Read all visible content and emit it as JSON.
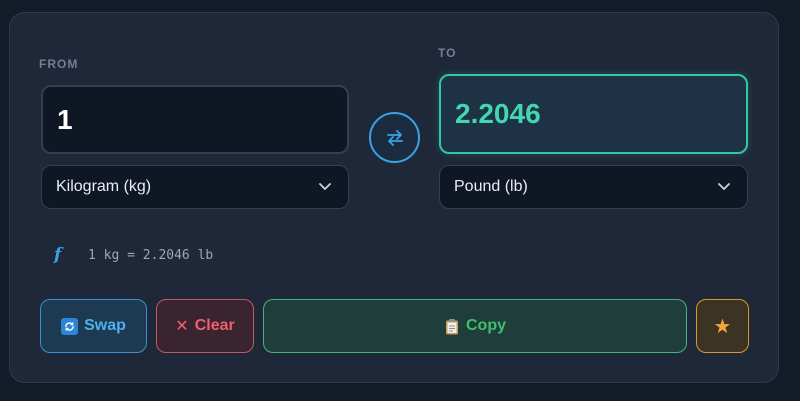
{
  "from": {
    "label": "FROM",
    "value": "1",
    "unit": "Kilogram (kg)"
  },
  "to": {
    "label": "TO",
    "value": "2.2046",
    "unit": "Pound (lb)"
  },
  "formula": {
    "icon": "function-icon",
    "symbol": "f",
    "text": "1 kg = 2.2046 lb"
  },
  "actions": {
    "swap_label": "Swap",
    "clear_icon": "✕",
    "clear_label": "Clear",
    "copy_label": "Copy",
    "star_icon": "★"
  },
  "colors": {
    "accent_blue": "#3aa2e6",
    "accent_teal": "#35c6a7",
    "danger": "#f05f6f",
    "success": "#3fc06c",
    "favorite": "#f2a53a"
  }
}
